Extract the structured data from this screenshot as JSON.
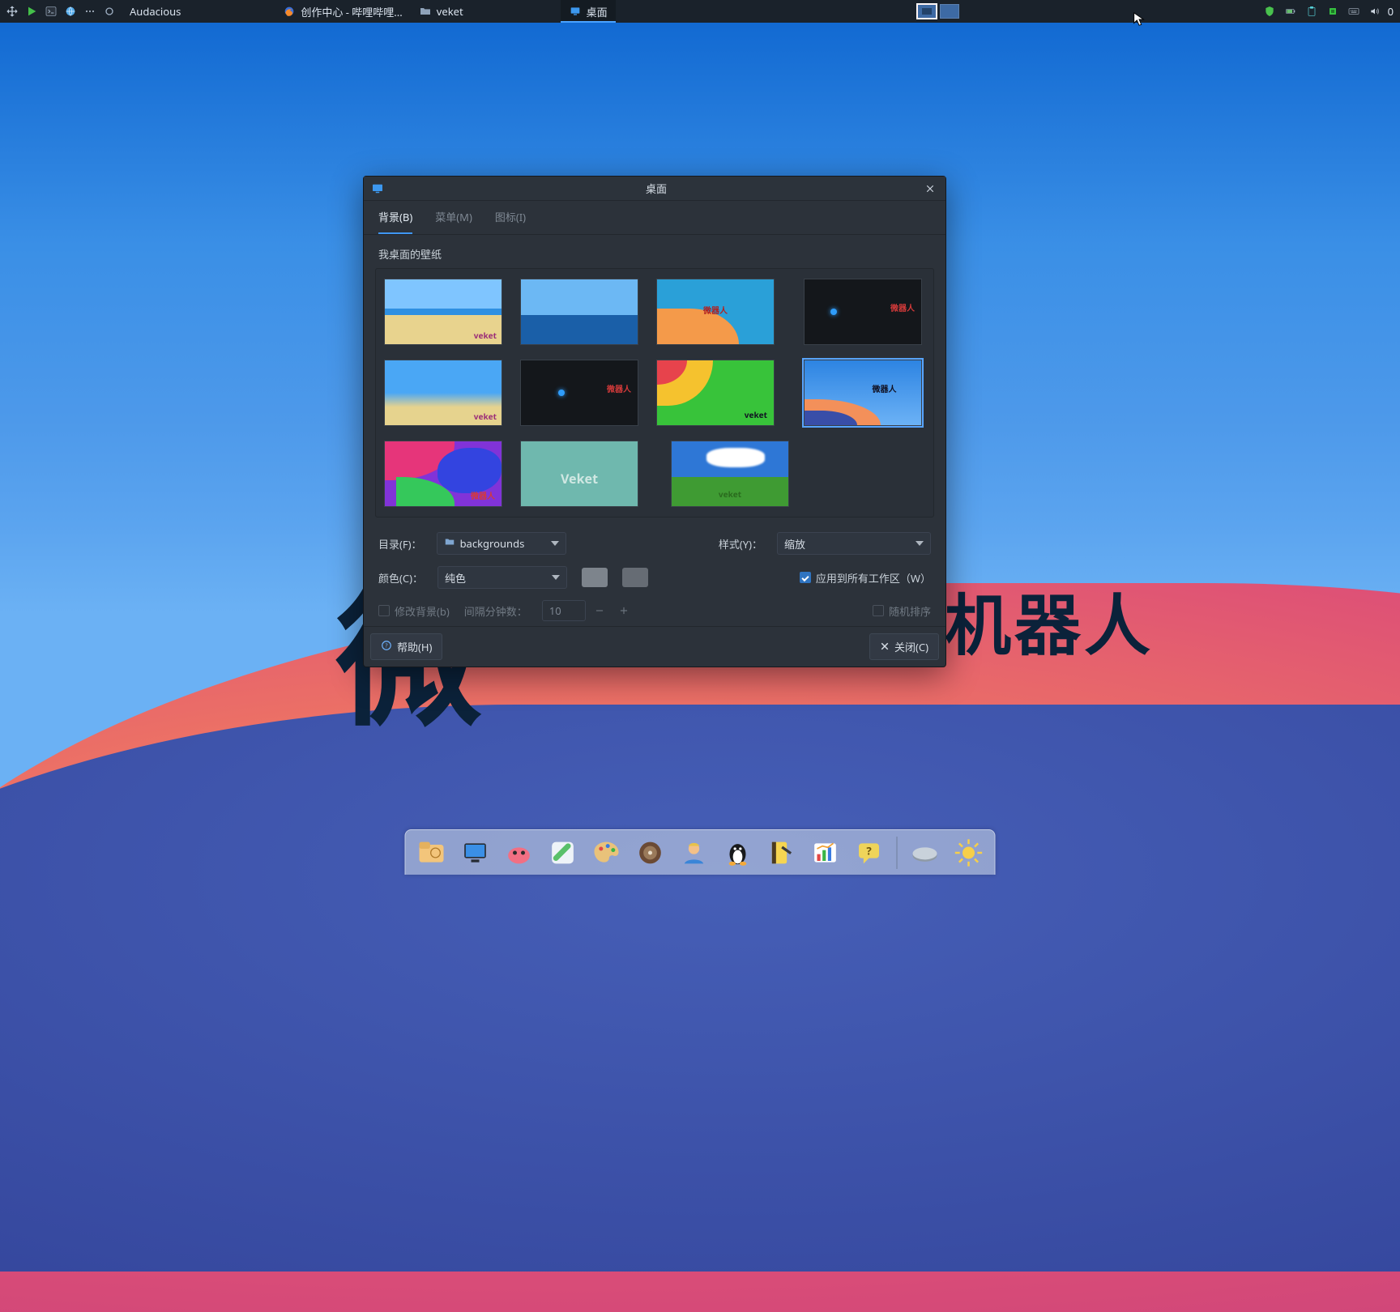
{
  "desktop": {
    "background_text_left": "微",
    "background_text_right": "机器人"
  },
  "panel": {
    "launchers": [
      "menu",
      "play",
      "terminal",
      "globe",
      "dots"
    ],
    "tasks": [
      {
        "icon": "audacious",
        "label": "Audacious"
      },
      {
        "icon": "firefox",
        "label": "创作中心 - 哔哩哔哩..."
      },
      {
        "icon": "folder",
        "label": "veket"
      },
      {
        "icon": "display",
        "label": "桌面",
        "active": true
      }
    ],
    "tray_icons": [
      "shield",
      "battery",
      "clipboard",
      "chip",
      "keyboard",
      "volume"
    ],
    "clock_digit": "0"
  },
  "dialog": {
    "title": "桌面",
    "tabs": [
      {
        "label": "背景(B)",
        "active": true
      },
      {
        "label": "菜单(M)"
      },
      {
        "label": "图标(I)"
      }
    ],
    "section_label": "我桌面的壁纸",
    "thumbs": [
      {
        "id": "beach-veket",
        "selected": false
      },
      {
        "id": "ocean",
        "selected": false
      },
      {
        "id": "blue-orange-robot",
        "selected": false
      },
      {
        "id": "dark-robot",
        "selected": false
      },
      {
        "id": "beach-veket-2",
        "selected": false
      },
      {
        "id": "dark-robot-2",
        "selected": false
      },
      {
        "id": "green-veket",
        "selected": false
      },
      {
        "id": "blue-gradient-robot",
        "selected": true
      },
      {
        "id": "multicolor-robot",
        "selected": false
      },
      {
        "id": "teal-veket",
        "selected": false
      },
      {
        "id": "field-veket",
        "selected": false
      }
    ],
    "dir_label": "目录(F)：",
    "dir_value": "backgrounds",
    "style_label": "样式(Y)：",
    "style_value": "缩放",
    "color_label": "颜色(C)：",
    "color_mode": "纯色",
    "apply_all_label": "应用到所有工作区（W）",
    "apply_all_checked": true,
    "modify_bg_label": "修改背景(b)",
    "modify_bg_checked": false,
    "interval_label": "间隔分钟数：",
    "interval_value": "10",
    "random_label": "随机排序",
    "random_checked": false,
    "help_label": "帮助(H)",
    "close_label": "关闭(C)"
  },
  "dock": {
    "items": [
      "files",
      "screenshot",
      "pig",
      "paint",
      "palette",
      "media",
      "user",
      "penguin",
      "notes",
      "chart",
      "help"
    ],
    "items2": [
      "drive",
      "brightness"
    ]
  }
}
